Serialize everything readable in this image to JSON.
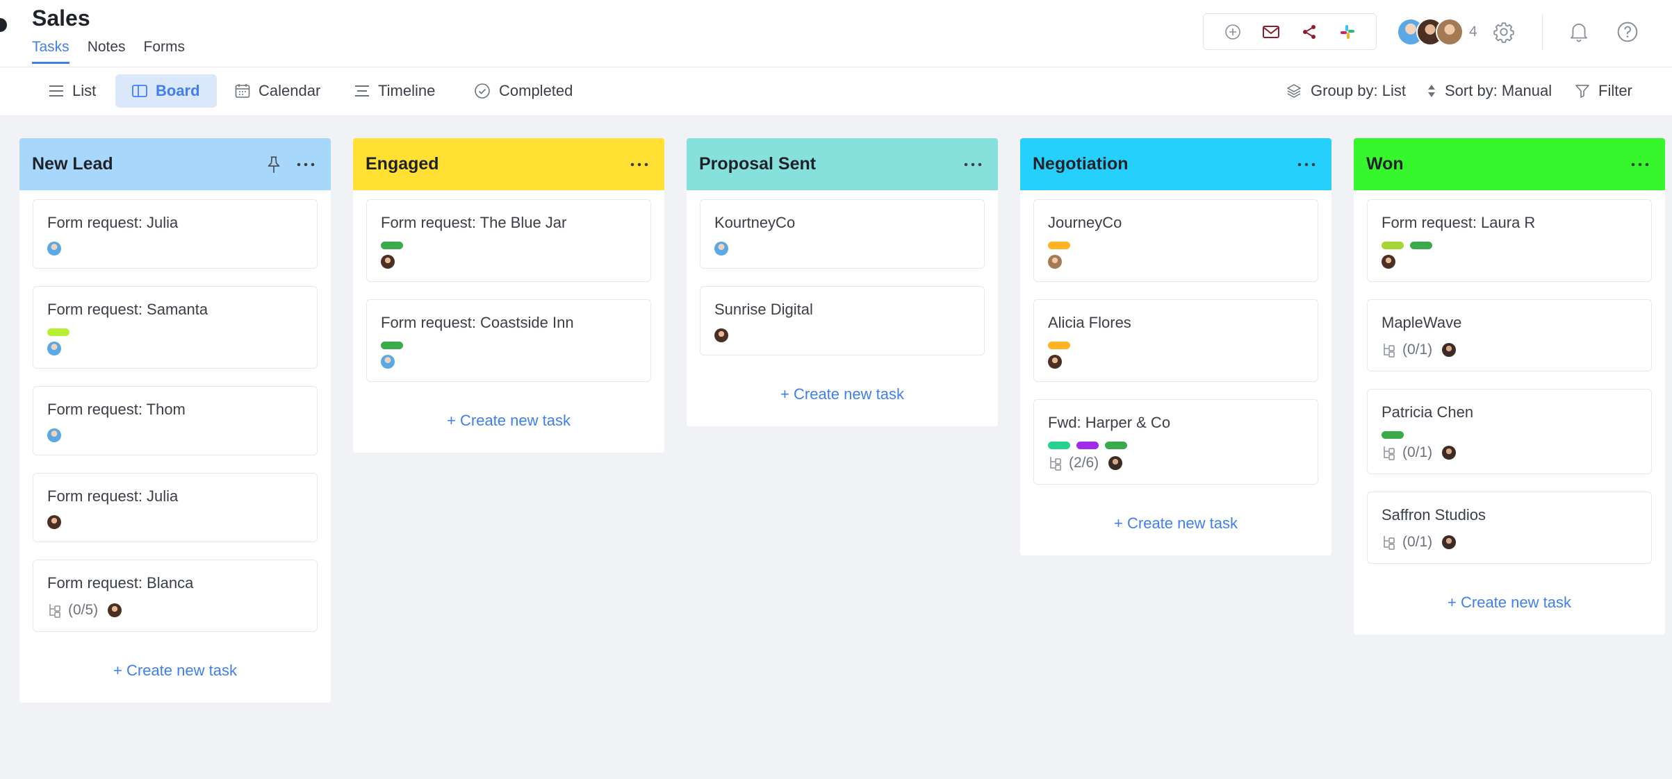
{
  "header": {
    "title": "Sales",
    "tabs": [
      {
        "label": "Tasks",
        "active": true
      },
      {
        "label": "Notes",
        "active": false
      },
      {
        "label": "Forms",
        "active": false
      }
    ],
    "integrations": [
      "add-integration-icon",
      "mail-icon",
      "share-icon",
      "slack-icon"
    ],
    "members_count": "4"
  },
  "toolbar": {
    "views": [
      {
        "label": "List",
        "icon": "list-icon"
      },
      {
        "label": "Board",
        "icon": "board-icon",
        "active": true
      },
      {
        "label": "Calendar",
        "icon": "calendar-icon"
      },
      {
        "label": "Timeline",
        "icon": "timeline-icon"
      },
      {
        "label": "Completed",
        "icon": "check-circle-icon"
      }
    ],
    "group_by": "Group by: List",
    "sort_by": "Sort by: Manual",
    "filter": "Filter"
  },
  "colors": {
    "accent": "#3f7ff0",
    "new_lead": "#a7d8fc",
    "engaged": "#ffe033",
    "proposal_sent": "#86e0dc",
    "negotiation": "#26d0fc",
    "won": "#35f72c",
    "label_green": "#3aaa4a",
    "label_lime": "#b6f033",
    "label_lime2": "#a3d636",
    "label_orange": "#ffb224",
    "label_teal": "#27d18e",
    "label_purple": "#a12be8"
  },
  "columns": [
    {
      "title": "New Lead",
      "cards": [
        {
          "title": "Form request: Julia"
        },
        {
          "title": "Form request: Samanta"
        },
        {
          "title": "Form request: Thom"
        },
        {
          "title": "Form request: Julia"
        },
        {
          "title": "Form request: Blanca",
          "subtasks": "(0/5)"
        }
      ],
      "create_label": "+ Create new task"
    },
    {
      "title": "Engaged",
      "cards": [
        {
          "title": "Form request: The Blue Jar"
        },
        {
          "title": "Form request: Coastside Inn"
        }
      ],
      "create_label": "+ Create new task"
    },
    {
      "title": "Proposal Sent",
      "cards": [
        {
          "title": "KourtneyCo"
        },
        {
          "title": "Sunrise Digital"
        }
      ],
      "create_label": "+ Create new task"
    },
    {
      "title": "Negotiation",
      "cards": [
        {
          "title": "JourneyCo"
        },
        {
          "title": "Alicia Flores"
        },
        {
          "title": "Fwd: Harper & Co",
          "subtasks": "(2/6)"
        }
      ],
      "create_label": "+ Create new task"
    },
    {
      "title": "Won",
      "cards": [
        {
          "title": "Form request: Laura R"
        },
        {
          "title": "MapleWave",
          "subtasks": "(0/1)"
        },
        {
          "title": "Patricia Chen",
          "subtasks": "(0/1)"
        },
        {
          "title": "Saffron Studios",
          "subtasks": "(0/1)"
        }
      ],
      "create_label": "+ Create new task"
    }
  ]
}
